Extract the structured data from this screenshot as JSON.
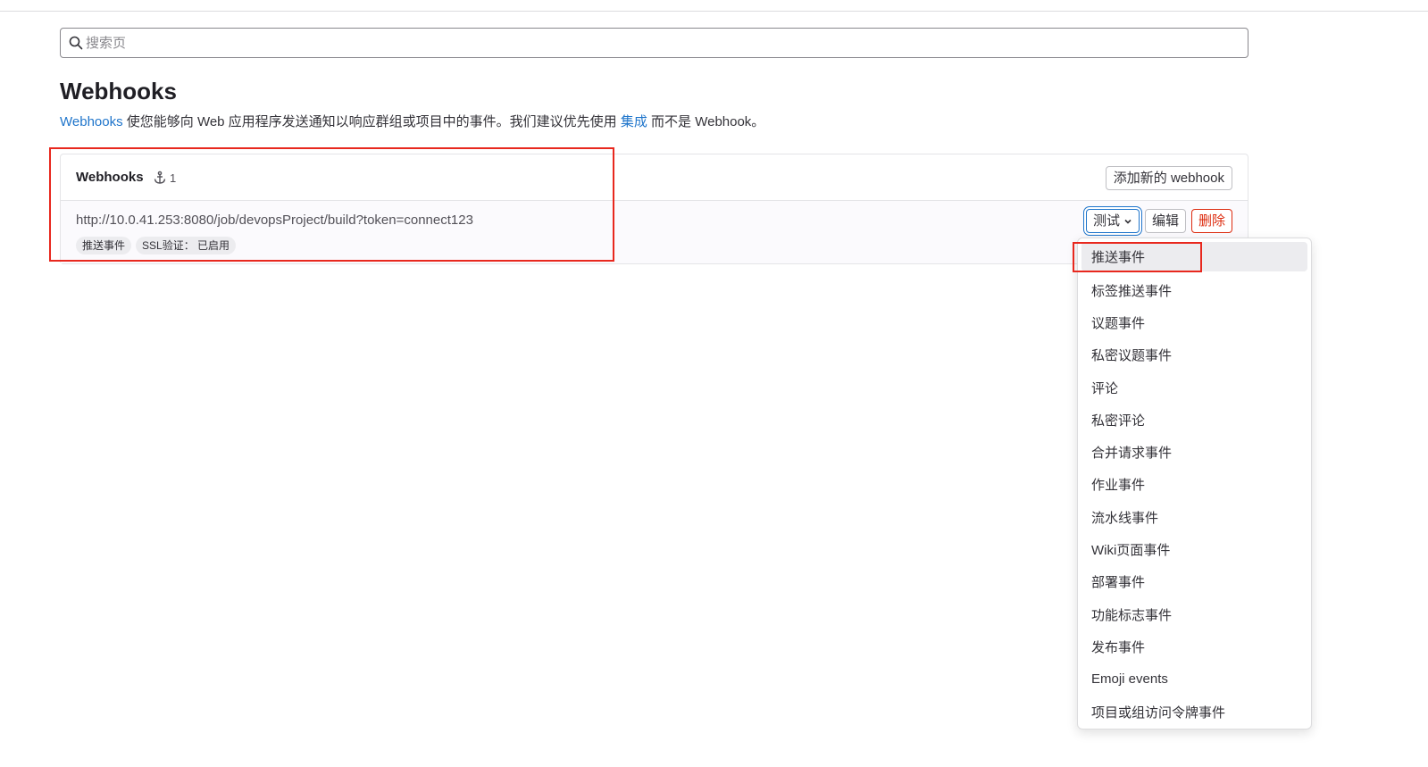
{
  "search": {
    "placeholder": "搜索页"
  },
  "page": {
    "title": "Webhooks",
    "description": {
      "link1": "Webhooks",
      "text1": " 使您能够向 Web 应用程序发送通知以响应群组或项目中的事件。我们建议优先使用 ",
      "link2": "集成",
      "text2": " 而不是 Webhook。"
    }
  },
  "card": {
    "title": "Webhooks",
    "count": "1",
    "add_label": "添加新的 webhook",
    "hooks": [
      {
        "url": "http://10.0.41.253:8080/job/devopsProject/build?token=connect123",
        "badges": [
          "推送事件",
          "SSL验证： 已启用"
        ],
        "test_label": "测试",
        "edit_label": "编辑",
        "delete_label": "删除"
      }
    ]
  },
  "dropdown": {
    "items": [
      "推送事件",
      "标签推送事件",
      "议题事件",
      "私密议题事件",
      "评论",
      "私密评论",
      "合并请求事件",
      "作业事件",
      "流水线事件",
      "Wiki页面事件",
      "部署事件",
      "功能标志事件",
      "发布事件",
      "Emoji events",
      "项目或组访问令牌事件"
    ]
  },
  "colors": {
    "link": "#1f75cb",
    "danger": "#dd2b0e",
    "highlight_box": "#e8281e"
  }
}
